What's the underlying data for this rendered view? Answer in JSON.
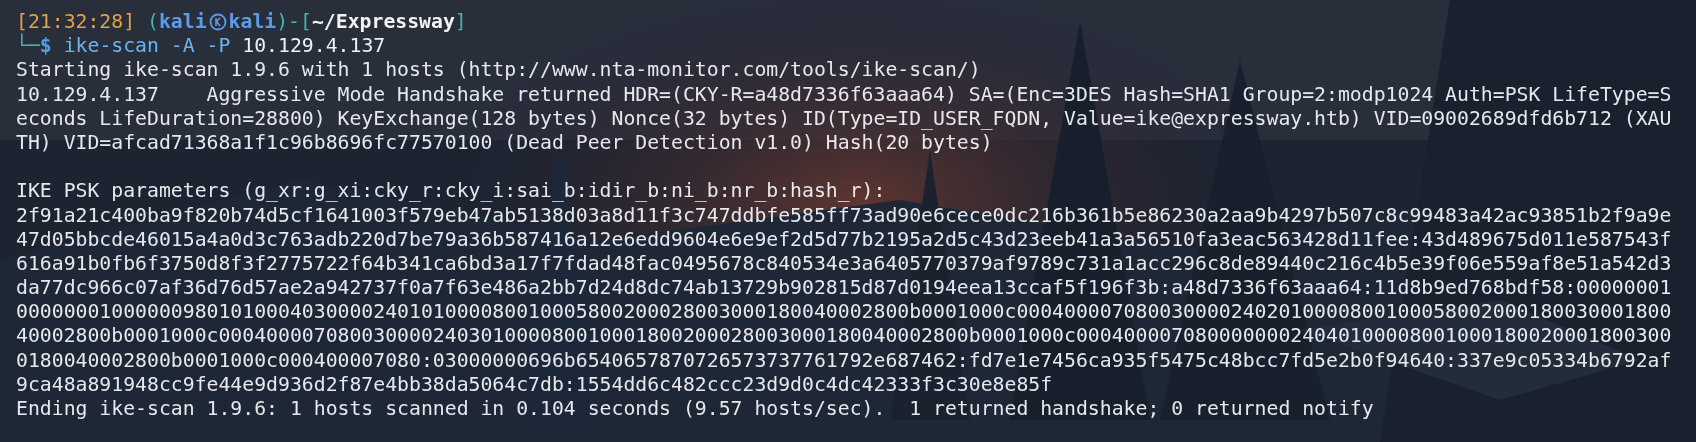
{
  "prompt": [
    {
      "kind": "time",
      "text": "[21:32:28]"
    },
    {
      "kind": "frame",
      "text": " ("
    },
    {
      "kind": "user",
      "text": "kali"
    },
    {
      "kind": "symbol"
    },
    {
      "kind": "user",
      "text": "kali"
    },
    {
      "kind": "frame",
      "text": ")-["
    },
    {
      "kind": "path",
      "text": "~/Expressway"
    },
    {
      "kind": "frame",
      "text": "]"
    }
  ],
  "command": [
    {
      "kind": "frame",
      "text": "└─"
    },
    {
      "kind": "sign",
      "text": "$ "
    },
    {
      "kind": "program",
      "text": "ike-scan -A -P "
    },
    {
      "kind": "arg",
      "text": "10.129.4.137"
    }
  ],
  "output_blocks": [
    [
      "Starting ike-scan 1.9.6 with 1 hosts (http://www.nta-monitor.com/tools/ike-scan/)",
      "10.129.4.137    Aggressive Mode Handshake returned HDR=(CKY-R=a48d7336f63aaa64) SA=(Enc=3DES Hash=SHA1 Group=2:modp1024 Auth=PSK LifeType=S",
      "econds LifeDuration=28800) KeyExchange(128 bytes) Nonce(32 bytes) ID(Type=ID_USER_FQDN, Value=ike@expressway.htb) VID=09002689dfd6b712 (XAU",
      "TH) VID=afcad71368a1f1c96b8696fc77570100 (Dead Peer Detection v1.0) Hash(20 bytes)"
    ],
    [
      "IKE PSK parameters (g_xr:g_xi:cky_r:cky_i:sai_b:idir_b:ni_b:nr_b:hash_r):",
      "2f91a21c400ba9f820b74d5cf1641003f579eb47ab5138d03a8d11f3c747ddbfe585ff73ad90e6cece0dc216b361b5e86230a2aa9b4297b507c8c99483a42ac93851b2f9a9e",
      "47d05bbcde46015a4a0d3c763adb220d7be79a36b587416a12e6edd9604e6e9ef2d5d77b2195a2d5c43d23eeb41a3a56510fa3eac563428d11fee:43d489675d011e587543f",
      "616a91b0fb6f3750d8f3f2775722f64b341ca6bd3a17f7fdad48fac0495678c840534e3a6405770379af9789c731a1acc296c8de89440c216c4b5e39f06e559af8e51a542d3",
      "da77dc966c07af36d76d57ae2a942737f0a7f63e486a2bb7d24d8dc74ab13729b902815d87d0194eea13ccaf5f196f3b:a48d7336f63aaa64:11d8b9ed768bdf58:00000001",
      "000000010000009801010004030000240101000080010005800200028003000180040002800b0001000c0004000070800300002402010000800100058002000180030001800",
      "40002800b0001000c000400007080030000240301000080010001800200028003000180040002800b0001000c00040000708000000024040100008001000180020001800300",
      "0180040002800b0001000c000400007080:03000000696b6540657870726573737761792e687462:fd7e1e7456ca935f5475c48bcc7fd5e2b0f94640:337e9c05334b6792af",
      "9ca48a891948cc9fe44e9d936d2f87e4bb38da5064c7db:1554dd6c482ccc23d9d0c4dc42333f3c30e8e85f",
      "Ending ike-scan 1.9.6: 1 hosts scanned in 0.104 seconds (9.57 hosts/sec).  1 returned handshake; 0 returned notify"
    ]
  ]
}
